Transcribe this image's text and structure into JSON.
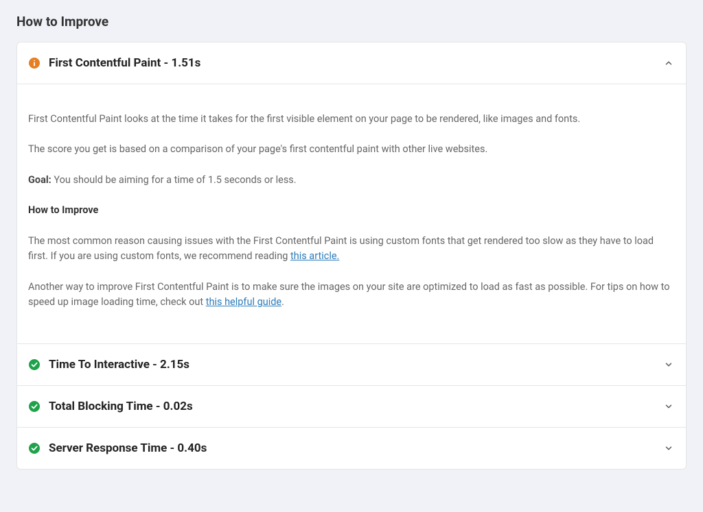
{
  "sectionTitle": "How to Improve",
  "colors": {
    "warning": "#e67e22",
    "success": "#1fa24a"
  },
  "items": [
    {
      "status": "warning",
      "title": "First Contentful Paint - 1.51s",
      "expanded": true,
      "body": {
        "intro1": "First Contentful Paint looks at the time it takes for the first visible element on your page to be rendered, like images and fonts.",
        "intro2": "The score you get is based on a comparison of your page's first contentful paint with other live websites.",
        "goalLabel": "Goal:",
        "goalText": " You should be aiming for a time of 1.5 seconds or less.",
        "howToImproveHeading": "How to Improve",
        "tip1a": "The most common reason causing issues with the First Contentful Paint is using custom fonts that get rendered too slow as they have to load first. If you are using custom fonts, we recommend reading ",
        "tip1Link": "this article.",
        "tip2a": "Another way to improve First Contentful Paint is to make sure the images on your site are optimized to load as fast as possible. For tips on how to speed up image loading time, check out ",
        "tip2Link": "this helpful guide",
        "tip2b": "."
      }
    },
    {
      "status": "success",
      "title": "Time To Interactive - 2.15s",
      "expanded": false
    },
    {
      "status": "success",
      "title": "Total Blocking Time - 0.02s",
      "expanded": false
    },
    {
      "status": "success",
      "title": "Server Response Time - 0.40s",
      "expanded": false
    }
  ]
}
